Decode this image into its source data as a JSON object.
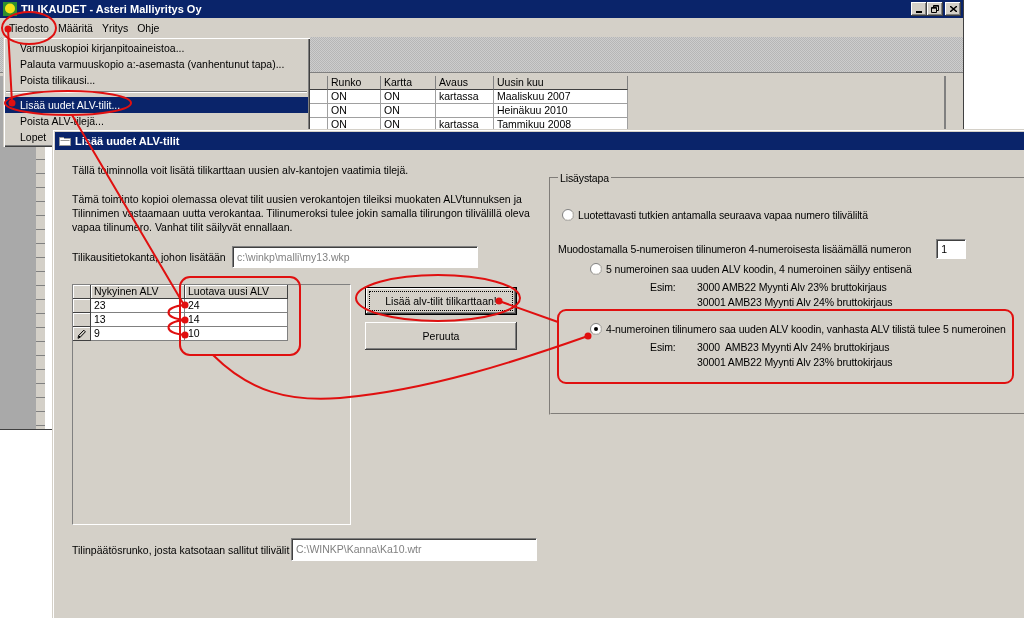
{
  "main_window": {
    "title": "TILIKAUDET - Asteri Malliyritys Oy",
    "menu": [
      "Tiedosto",
      "Määritä",
      "Yritys",
      "Ohje"
    ]
  },
  "file_menu": [
    {
      "kind": "item",
      "label": "Varmuuskopioi kirjanpitoaineistoa...",
      "selected": false
    },
    {
      "kind": "item",
      "label": "Palauta varmuuskopio a:-asemasta (vanhentunut tapa)...",
      "selected": false
    },
    {
      "kind": "item",
      "label": "Poista tilikausi...",
      "selected": false
    },
    {
      "kind": "separator"
    },
    {
      "kind": "item",
      "label": "Lisää uudet ALV-tilit...",
      "selected": true
    },
    {
      "kind": "item",
      "label": "Poista ALV-tilejä...",
      "selected": false
    },
    {
      "kind": "item",
      "label": "Lopet",
      "selected": false
    }
  ],
  "periods_table": {
    "columns": [
      "Runko",
      "Kartta",
      "Avaus",
      "Uusin kuu"
    ],
    "rows": [
      [
        "ON",
        "ON",
        "kartassa",
        "Maaliskuu 2007"
      ],
      [
        "ON",
        "ON",
        null,
        "Heinäkuu 2010"
      ],
      [
        "ON",
        "ON",
        "kartassa",
        "Tammikuu 2008"
      ]
    ]
  },
  "dialog": {
    "title": "Lisää uudet ALV-tilit",
    "intro": "Tällä toiminnolla voit lisätä tilikarttaan uusien alv-kantojen vaatimia tilejä.",
    "description": "Tämä toiminto kopioi olemassa olevat tilit uusien verokantojen tileiksi muokaten ALVtunnuksen ja Tilinnimen vastaamaan uutta verokantaa. Tilinumeroksi tulee jokin samalla tilirungon tilivälillä oleva vapaa tilinumero. Vanhat tilit säilyvät ennallaan.",
    "database": {
      "label": "Tilikausitietokanta, johon lisätään",
      "value": "c:\\winkp\\malli\\my13.wkp",
      "disabled": true
    },
    "rate_grid": {
      "columns": [
        "Nykyinen ALV",
        "Luotava uusi ALV"
      ],
      "rows": [
        {
          "current": "23",
          "new": "24",
          "editing": false
        },
        {
          "current": "13",
          "new": "14",
          "editing": false
        },
        {
          "current": "9",
          "new": "10",
          "editing": true
        }
      ]
    },
    "buttons": [
      {
        "label": "Lisää alv-tilit tilikarttaan!",
        "default": true
      },
      {
        "label": "Peruuta",
        "default": false
      }
    ],
    "method_group": {
      "title": "Lisäystapa",
      "options": [
        {
          "kind": "radio",
          "label": "Luotettavasti tutkien antamalla seuraava vapaa numero tiliväliltä",
          "selected": false
        },
        {
          "kind": "field",
          "label": "Muodostamalla 5-numeroisen tilinumeron 4-numeroisesta lisäämällä numeron",
          "value": "1",
          "children": [
            {
              "kind": "radio",
              "label": "5 numeroinen saa uuden ALV koodin, 4 numeroinen säilyy entisenä",
              "selected": false,
              "example_label": "Esim:",
              "examples": [
                "3000 AMB22 Myynti Alv 23% bruttokirjaus",
                "30001 AMB23 Myynti Alv 24% bruttokirjaus"
              ]
            },
            {
              "kind": "radio",
              "label": "4-numeroinen tilinumero saa uuden ALV koodin, vanhasta ALV tilistä tulee 5 numeroinen",
              "selected": true,
              "example_label": "Esim:",
              "examples": [
                "3000  AMB23 Myynti Alv 24% bruttokirjaus",
                "30001 AMB22 Myynti Alv 23% bruttokirjaus"
              ]
            }
          ]
        }
      ]
    },
    "chart_file": {
      "label": "Tilinpäätösrunko, josta katsotaan sallitut tilivälit",
      "value": "C:\\WINKP\\Kanna\\Ka10.wtr",
      "disabled": true
    }
  }
}
